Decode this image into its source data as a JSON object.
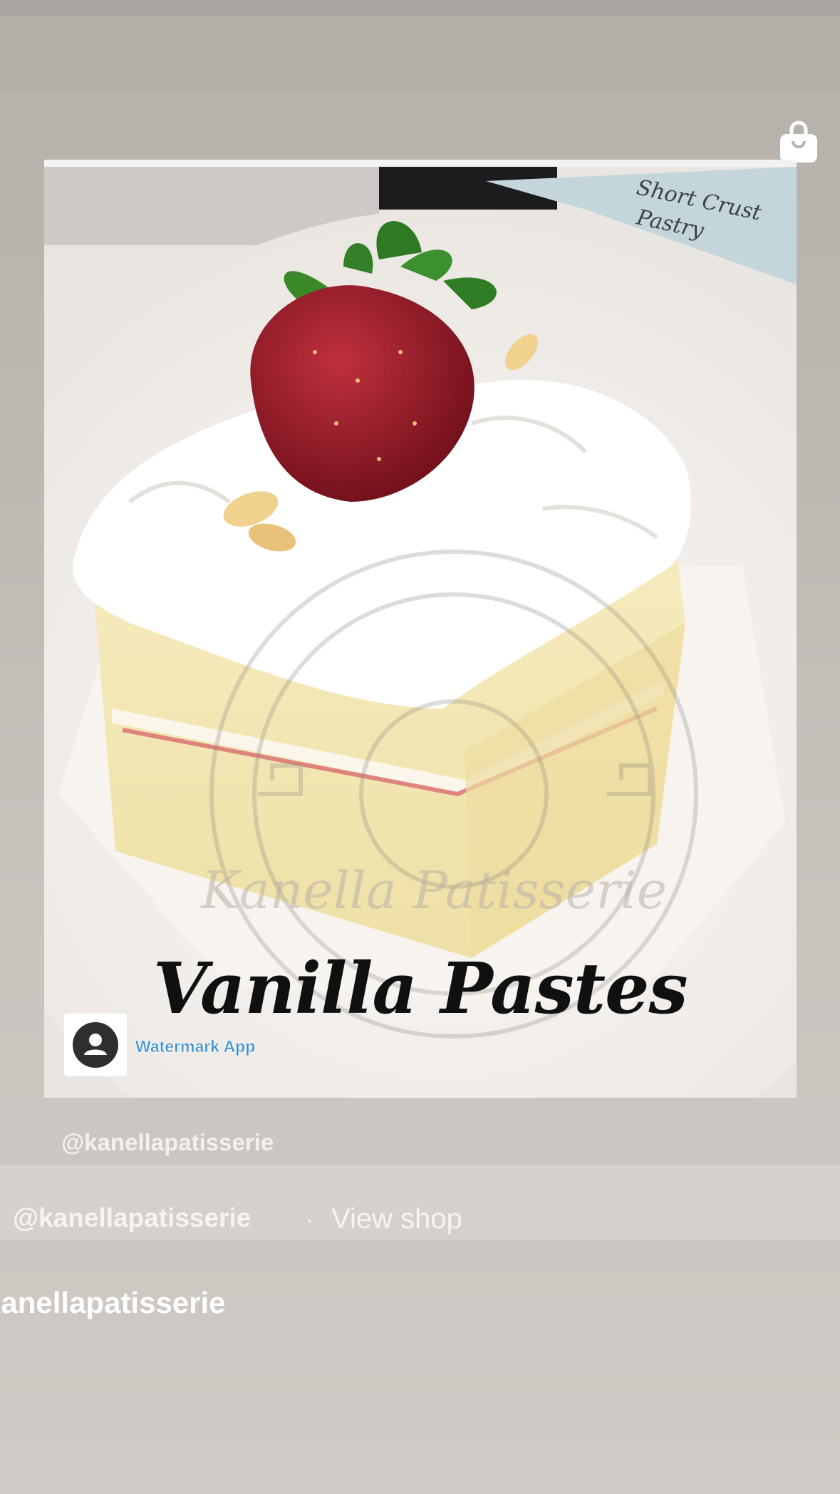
{
  "story": {
    "product_title": "Vanilla Pastes",
    "watermark_label": "Watermark App",
    "photo_caption": "@kanellapatisserie",
    "attribution_handle": "@kanellapatisserie",
    "separator": "·",
    "view_shop_label": "View shop",
    "username": "kanellapatisserie",
    "background_book_text": [
      "Short Crust",
      "Pastry"
    ],
    "photo_watermark_text": "Kanella Patisserie"
  },
  "icons": {
    "shop": "shopping-bag-icon",
    "avatar": "user-avatar-icon"
  },
  "colors": {
    "background": "#bdb8b2",
    "text_light": "#f6f4f2",
    "watermark_blue": "#3a8fd0"
  }
}
